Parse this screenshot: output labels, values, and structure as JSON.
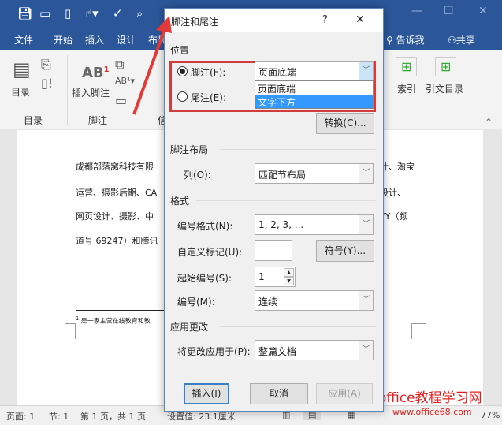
{
  "quick_access": {
    "icons": [
      "save-icon",
      "open-icon",
      "new-icon",
      "touch-mode-icon",
      "spelling-icon",
      "print-preview-icon"
    ]
  },
  "tabs": [
    "文件",
    "开始",
    "插入",
    "设计",
    "布局"
  ],
  "tell_me": "告诉我",
  "share": "共享",
  "ribbon": {
    "toc_button": "目录",
    "toc_group": "目录",
    "insert_footnote": "插入脚注",
    "footnote_group": "脚注",
    "citation_group_partial": "信",
    "index_button": "索引",
    "toa_button": "引文目录"
  },
  "document": {
    "lines": [
      "成都部落窝科技有限",
      "运营、摄影后期、CA",
      "网页设计、摄影、中",
      "道号 69247）和腾讯"
    ],
    "right_fragments": [
      "计、淘宝",
      "设计、",
      "YY（频"
    ],
    "footnote": "是一家主营在线教育和教",
    "footnote_mark": "1"
  },
  "status": {
    "page": "页面: 1",
    "section": "节: 1",
    "page_of": "第 1 页，共 1 页",
    "setting": "设置值: 23.1厘米",
    "zoom": "77%"
  },
  "dialog": {
    "title": "脚注和尾注",
    "help": "?",
    "close": "✕",
    "position_section": "位置",
    "footnote_label": "脚注(F):",
    "footnote_selected": true,
    "footnote_value": "页面底端",
    "footnote_options": [
      "页面底端",
      "文字下方"
    ],
    "highlighted_option": "文字下方",
    "endnote_label": "尾注(E):",
    "convert_button": "转换(C)...",
    "layout_section": "脚注布局",
    "columns_label": "列(O):",
    "columns_value": "匹配节布局",
    "format_section": "格式",
    "number_format_label": "编号格式(N):",
    "number_format_value": "1, 2, 3, ...",
    "custom_mark_label": "自定义标记(U):",
    "custom_mark_value": "",
    "symbol_button": "符号(Y)...",
    "start_at_label": "起始编号(S):",
    "start_at_value": "1",
    "numbering_label": "编号(M):",
    "numbering_value": "连续",
    "apply_section": "应用更改",
    "apply_to_label": "将更改应用于(P):",
    "apply_to_value": "整篇文档",
    "insert_button": "插入(I)",
    "cancel_button": "取消",
    "apply_button": "应用(A)"
  },
  "watermark": {
    "title": "office教程学习网",
    "url": "www.office68.com"
  },
  "colors": {
    "brand": "#2b579a",
    "highlight": "#3399ff",
    "annotation": "#e03a3a"
  }
}
